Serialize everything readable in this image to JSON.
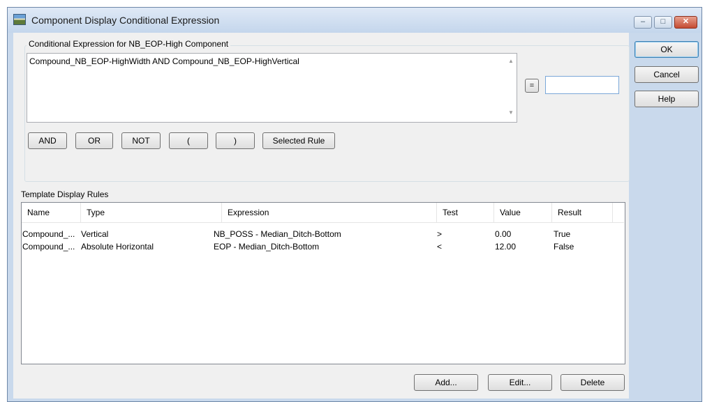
{
  "window": {
    "title": "Component Display Conditional Expression",
    "controls": {
      "minimize": "–",
      "maximize": "□",
      "close": "✕"
    }
  },
  "condition_group": {
    "label": "Conditional Expression for NB_EOP-High Component",
    "expression": "Compound_NB_EOP-HighWidth AND Compound_NB_EOP-HighVertical",
    "equals_label": "=",
    "value_input": "",
    "operators": [
      "AND",
      "OR",
      "NOT",
      "(",
      ")",
      "Selected Rule"
    ]
  },
  "rules": {
    "label": "Template Display Rules",
    "columns": [
      "Name",
      "Type",
      "Expression",
      "Test",
      "Value",
      "Result"
    ],
    "rows": [
      {
        "name": "Compound_...",
        "type": "Vertical",
        "expression": "NB_POSS - Median_Ditch-Bottom",
        "test": ">",
        "value": "0.00",
        "result": "True"
      },
      {
        "name": "Compound_...",
        "type": "Absolute Horizontal",
        "expression": "EOP - Median_Ditch-Bottom",
        "test": "<",
        "value": "12.00",
        "result": "False"
      }
    ]
  },
  "bottom_buttons": {
    "add": "Add...",
    "edit": "Edit...",
    "delete": "Delete"
  },
  "side_buttons": {
    "ok": "OK",
    "cancel": "Cancel",
    "help": "Help"
  }
}
